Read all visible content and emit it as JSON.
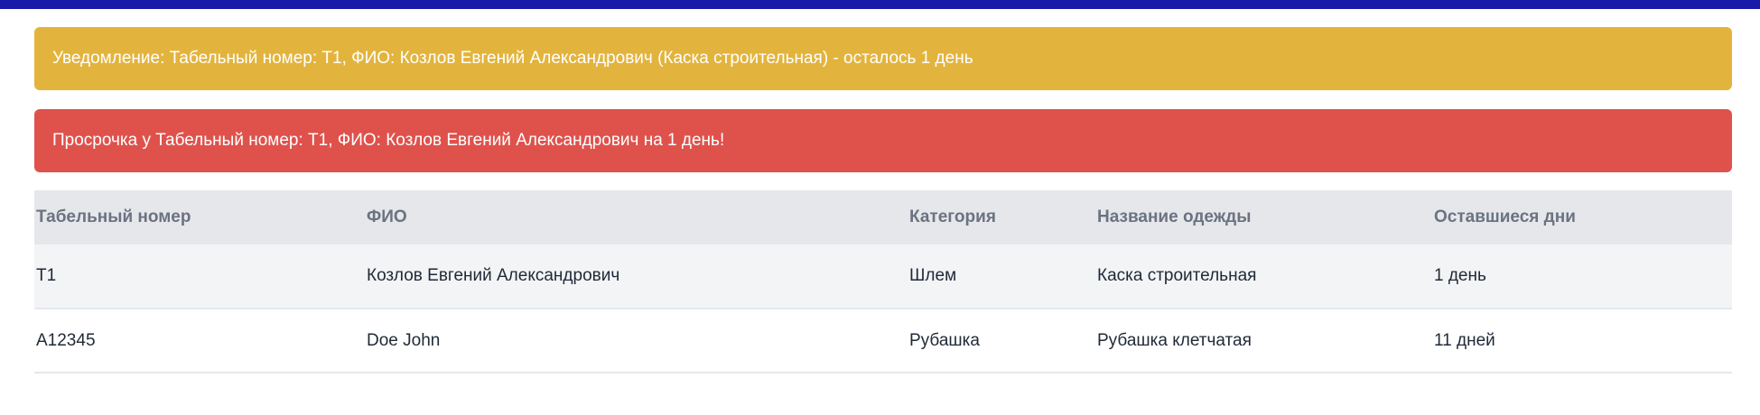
{
  "alerts": {
    "warning": "Уведомление: Табельный номер: Т1, ФИО: Козлов Евгений Александрович (Каска строительная) - осталось 1 день",
    "danger": "Просрочка у Табельный номер: Т1, ФИО: Козлов Евгений Александрович на 1 день!"
  },
  "table": {
    "headers": [
      "Табельный номер",
      "ФИО",
      "Категория",
      "Название одежды",
      "Оставшиеся дни"
    ],
    "rows": [
      [
        "Т1",
        "Козлов Евгений Александрович",
        "Шлем",
        "Каска строительная",
        "1 день"
      ],
      [
        "A12345",
        "Doe John",
        "Рубашка",
        "Рубашка клетчатая",
        "11 дней"
      ]
    ]
  },
  "colors": {
    "top_bar": "#1a1aaa",
    "warning": "#e3b43d",
    "danger": "#df524c"
  }
}
